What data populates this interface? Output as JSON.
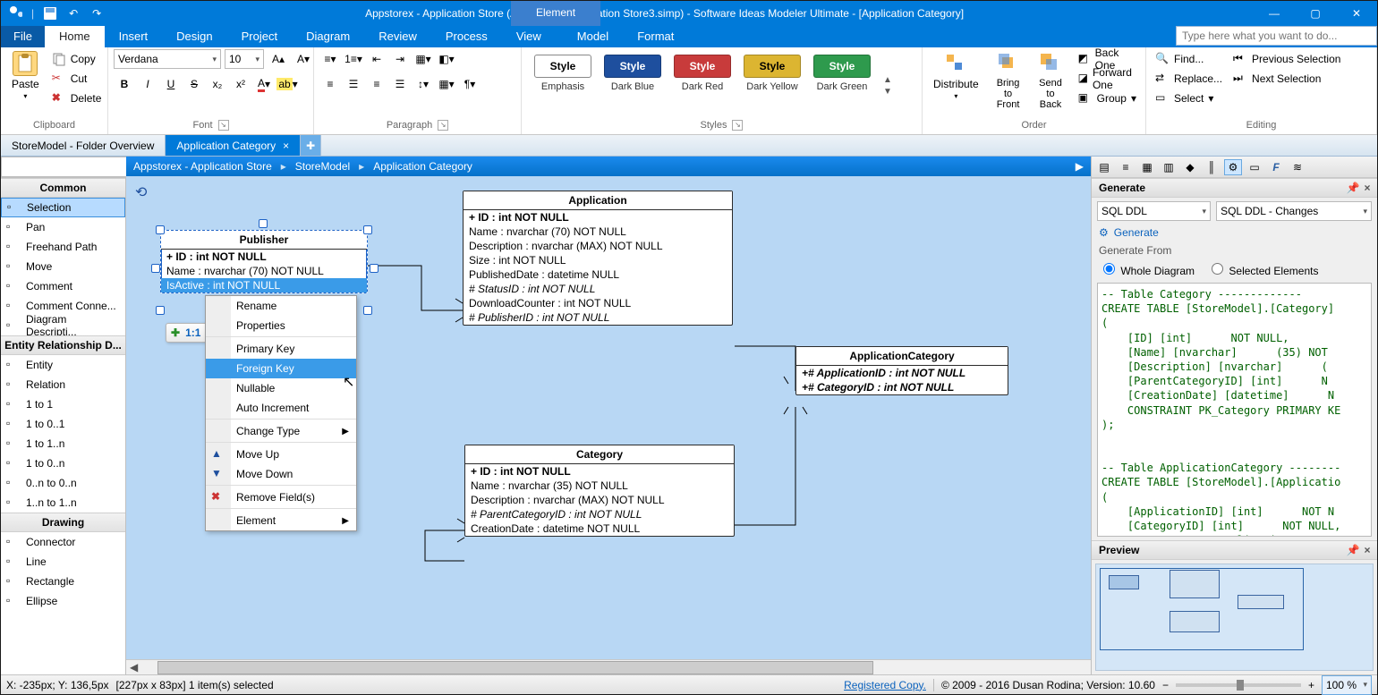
{
  "window": {
    "title": "Appstorex - Application Store (Appstorex - Application Store3.simp)  - Software Ideas Modeler Ultimate - [Application Category]",
    "context_tab": "Element"
  },
  "menubar": {
    "file": "File",
    "items": [
      "Home",
      "Insert",
      "Design",
      "Project",
      "Diagram",
      "Review",
      "Process",
      "View",
      "Model",
      "Format"
    ],
    "active": "Home",
    "help_placeholder": "Type here what you want to do..."
  },
  "ribbon": {
    "clipboard": {
      "paste": "Paste",
      "copy": "Copy",
      "cut": "Cut",
      "delete": "Delete",
      "label": "Clipboard"
    },
    "font": {
      "name": "Verdana",
      "size": "10",
      "label": "Font"
    },
    "paragraph": {
      "label": "Paragraph"
    },
    "styles": {
      "label": "Styles",
      "items": [
        {
          "text": "Style",
          "caption": "Emphasis",
          "bg": "#fff",
          "fg": "#000",
          "border": "#888"
        },
        {
          "text": "Style",
          "caption": "Dark Blue",
          "bg": "#1e4f9e",
          "fg": "#fff"
        },
        {
          "text": "Style",
          "caption": "Dark Red",
          "bg": "#c83b3b",
          "fg": "#fff"
        },
        {
          "text": "Style",
          "caption": "Dark Yellow",
          "bg": "#dcb531",
          "fg": "#000"
        },
        {
          "text": "Style",
          "caption": "Dark Green",
          "bg": "#2e9a4d",
          "fg": "#fff"
        }
      ]
    },
    "order": {
      "label": "Order",
      "distribute": "Distribute",
      "bringfront": "Bring to Front",
      "sendback": "Send to Back",
      "backone": "Back One",
      "forwardone": "Forward One",
      "group": "Group"
    },
    "editing": {
      "label": "Editing",
      "find": "Find...",
      "replace": "Replace...",
      "select": "Select",
      "prevsel": "Previous Selection",
      "nextsel": "Next Selection"
    }
  },
  "doctabs": {
    "tabs": [
      {
        "label": "StoreModel - Folder Overview",
        "active": false
      },
      {
        "label": "Application Category",
        "active": true
      }
    ]
  },
  "breadcrumb": [
    "Appstorex - Application Store",
    "StoreModel",
    "Application Category"
  ],
  "toolbox": {
    "common_label": "Common",
    "common": [
      "Selection",
      "Pan",
      "Freehand Path",
      "Move",
      "Comment",
      "Comment Conne...",
      "Diagram Descripti..."
    ],
    "erd_label": "Entity Relationship D...",
    "erd": [
      "Entity",
      "Relation",
      "1 to 1",
      "1 to 0..1",
      "1 to 1..n",
      "1 to 0..n",
      "0..n to 0..n",
      "1..n to 1..n"
    ],
    "drawing_label": "Drawing",
    "drawing": [
      "Connector",
      "Line",
      "Rectangle",
      "Ellipse"
    ]
  },
  "diagram": {
    "publisher": {
      "name": "Publisher",
      "rows": [
        "+ ID : int NOT NULL",
        "Name : nvarchar (70)  NOT NULL",
        "IsActive : int NOT NULL"
      ]
    },
    "application": {
      "name": "Application",
      "rows": [
        "+ ID : int NOT NULL",
        "Name : nvarchar (70)  NOT NULL",
        "Description : nvarchar (MAX)  NOT NULL",
        "Size : int NOT NULL",
        "PublishedDate : datetime NULL",
        "# StatusID : int NOT NULL",
        "DownloadCounter : int NOT NULL",
        "# PublisherID : int NOT NULL"
      ]
    },
    "category": {
      "name": "Category",
      "rows": [
        "+ ID : int NOT NULL",
        "Name : nvarchar (35)  NOT NULL",
        "Description : nvarchar (MAX)  NOT NULL",
        "# ParentCategoryID : int NOT NULL",
        "CreationDate : datetime NOT NULL"
      ]
    },
    "appcat": {
      "name": "ApplicationCategory",
      "rows": [
        "+# ApplicationID : int NOT NULL",
        "+# CategoryID : int NOT NULL"
      ]
    }
  },
  "minitoolbar": {
    "label": "1:1"
  },
  "contextmenu": {
    "items": [
      {
        "label": "Rename"
      },
      {
        "label": "Properties",
        "sep": true
      },
      {
        "label": "Primary Key"
      },
      {
        "label": "Foreign Key",
        "hover": true
      },
      {
        "label": "Nullable"
      },
      {
        "label": "Auto Increment",
        "sep": true
      },
      {
        "label": "Change Type",
        "sub": true,
        "sep": true
      },
      {
        "label": "Move Up",
        "icon": "up"
      },
      {
        "label": "Move Down",
        "icon": "down",
        "sep": true
      },
      {
        "label": "Remove Field(s)",
        "icon": "remove",
        "sep": true
      },
      {
        "label": "Element",
        "sub": true
      }
    ]
  },
  "rightpanel": {
    "generate": {
      "title": "Generate",
      "combo1": "SQL DDL",
      "combo2": "SQL DDL - Changes",
      "button": "Generate",
      "from": "Generate From",
      "opt1": "Whole Diagram",
      "opt2": "Selected Elements"
    },
    "code": "-- Table Category -------------\nCREATE TABLE [StoreModel].[Category]\n(\n    [ID] [int]      NOT NULL,\n    [Name] [nvarchar]      (35) NOT\n    [Description] [nvarchar]      (\n    [ParentCategoryID] [int]      N\n    [CreationDate] [datetime]      N\n    CONSTRAINT PK_Category PRIMARY KE\n);\n\n\n-- Table ApplicationCategory --------\nCREATE TABLE [StoreModel].[Applicatio\n(\n    [ApplicationID] [int]      NOT N\n    [CategoryID] [int]      NOT NULL,\n    CONSTRAINT PK ApplicationCategory",
    "preview": {
      "title": "Preview"
    }
  },
  "statusbar": {
    "coords": "X: -235px; Y: 136,5px",
    "sel": "[227px x 83px] 1 item(s) selected",
    "reg": "Registered Copy.",
    "ver": "© 2009 - 2016 Dusan Rodina; Version: 10.60",
    "zoom": "100 %"
  }
}
